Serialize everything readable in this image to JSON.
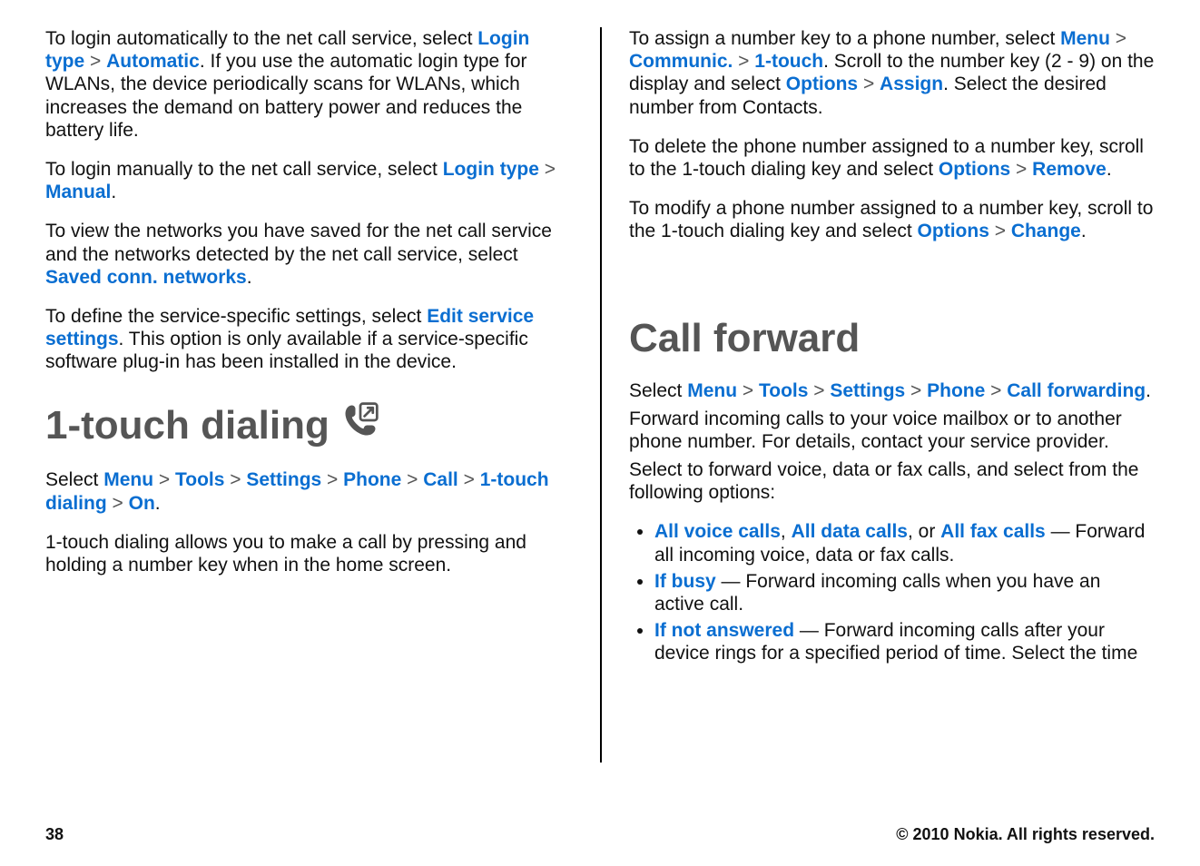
{
  "left": {
    "p1": {
      "t1": "To login automatically to the net call service, select ",
      "kw1": "Login type",
      "gt1": " > ",
      "kw2": "Automatic",
      "t2": ". If you use the automatic login type for WLANs, the device periodically scans for WLANs, which increases the demand on battery power and reduces the battery life."
    },
    "p2": {
      "t1": "To login manually to the net call service, select ",
      "kw1": "Login type",
      "gt1": " > ",
      "kw2": "Manual",
      "t2": "."
    },
    "p3": {
      "t1": "To view the networks you have saved for the net call service and the networks detected by the net call service, select ",
      "kw1": "Saved conn. networks",
      "t2": "."
    },
    "p4": {
      "t1": "To define the service-specific settings, select ",
      "kw1": "Edit service settings",
      "t2": ". This option is only available if a service-specific software plug-in has been installed in the device."
    },
    "h1": "1-touch dialing",
    "bc": {
      "pre": "Select ",
      "k1": "Menu",
      "g1": " > ",
      "k2": "Tools",
      "g2": " > ",
      "k3": "Settings",
      "g3": " > ",
      "k4": "Phone",
      "g4": " > ",
      "k5": "Call",
      "g5": " > ",
      "k6": "1-touch dialing",
      "g6": " > ",
      "k7": "On",
      "tail": "."
    },
    "p5": "1-touch dialing allows you to make a call by pressing and holding a number key when in the home screen."
  },
  "right": {
    "p1": {
      "t1": "To assign a number key to a phone number, select ",
      "kw1": "Menu",
      "g1": " > ",
      "kw2": "Communic.",
      "g2": " > ",
      "kw3": "1-touch",
      "t2": ". Scroll to the number key (2 - 9) on the display and select ",
      "kw4": "Options",
      "g3": " > ",
      "kw5": "Assign",
      "t3": ". Select the desired number from Contacts."
    },
    "p2": {
      "t1": "To delete the phone number assigned to a number key, scroll to the 1-touch dialing key and select ",
      "kw1": "Options",
      "g1": " > ",
      "kw2": "Remove",
      "t2": "."
    },
    "p3": {
      "t1": "To modify a phone number assigned to a number key, scroll to the 1-touch dialing key and select ",
      "kw1": "Options",
      "g1": " > ",
      "kw2": "Change",
      "t2": "."
    },
    "h1": "Call forward",
    "bc": {
      "pre": "Select ",
      "k1": "Menu",
      "g1": " > ",
      "k2": "Tools",
      "g2": " > ",
      "k3": "Settings",
      "g3": " > ",
      "k4": "Phone",
      "g4": " > ",
      "k5": "Call forwarding",
      "tail": "."
    },
    "p4": "Forward incoming calls to your voice mailbox or to another phone number. For details, contact your service provider.",
    "p5": "Select to forward voice, data or fax calls, and select from the following options:",
    "li1": {
      "kw1": "All voice calls",
      "c1": ", ",
      "kw2": "All data calls",
      "c2": ", or ",
      "kw3": "All fax calls",
      "t": " — Forward all incoming voice, data or fax calls."
    },
    "li2": {
      "kw1": "If busy",
      "t": "  — Forward incoming calls when you have an active call."
    },
    "li3": {
      "kw1": "If not answered",
      "t": "  — Forward incoming calls after your device rings for a specified period of time. Select the time"
    }
  },
  "footer": {
    "page": "38",
    "copyright": "© 2010 Nokia. All rights reserved."
  }
}
